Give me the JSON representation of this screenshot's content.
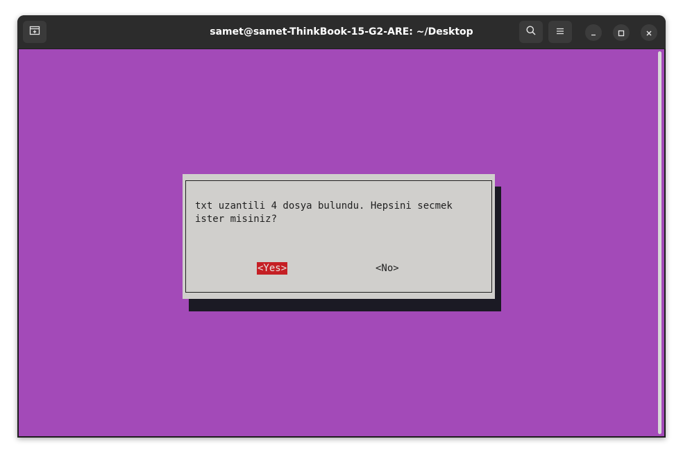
{
  "window": {
    "title": "samet@samet-ThinkBook-15-G2-ARE: ~/Desktop"
  },
  "titlebar_icons": {
    "new_tab": "new-tab-icon",
    "search": "search-icon",
    "menu": "hamburger-menu-icon",
    "minimize": "minimize-icon",
    "maximize": "maximize-icon",
    "close": "close-icon"
  },
  "colors": {
    "terminal_background": "#a34ab8",
    "dialog_background": "#d0cfcc",
    "dialog_shadow": "#1b1a24",
    "selected_button_background": "#c51f24",
    "titlebar": "#2c2c2c"
  },
  "dialog": {
    "message": "txt uzantili 4 dosya bulundu. Hepsini secmek\nister misiniz?",
    "yes_label": "<Yes>",
    "no_label": "<No>",
    "selected_button": "yes"
  }
}
